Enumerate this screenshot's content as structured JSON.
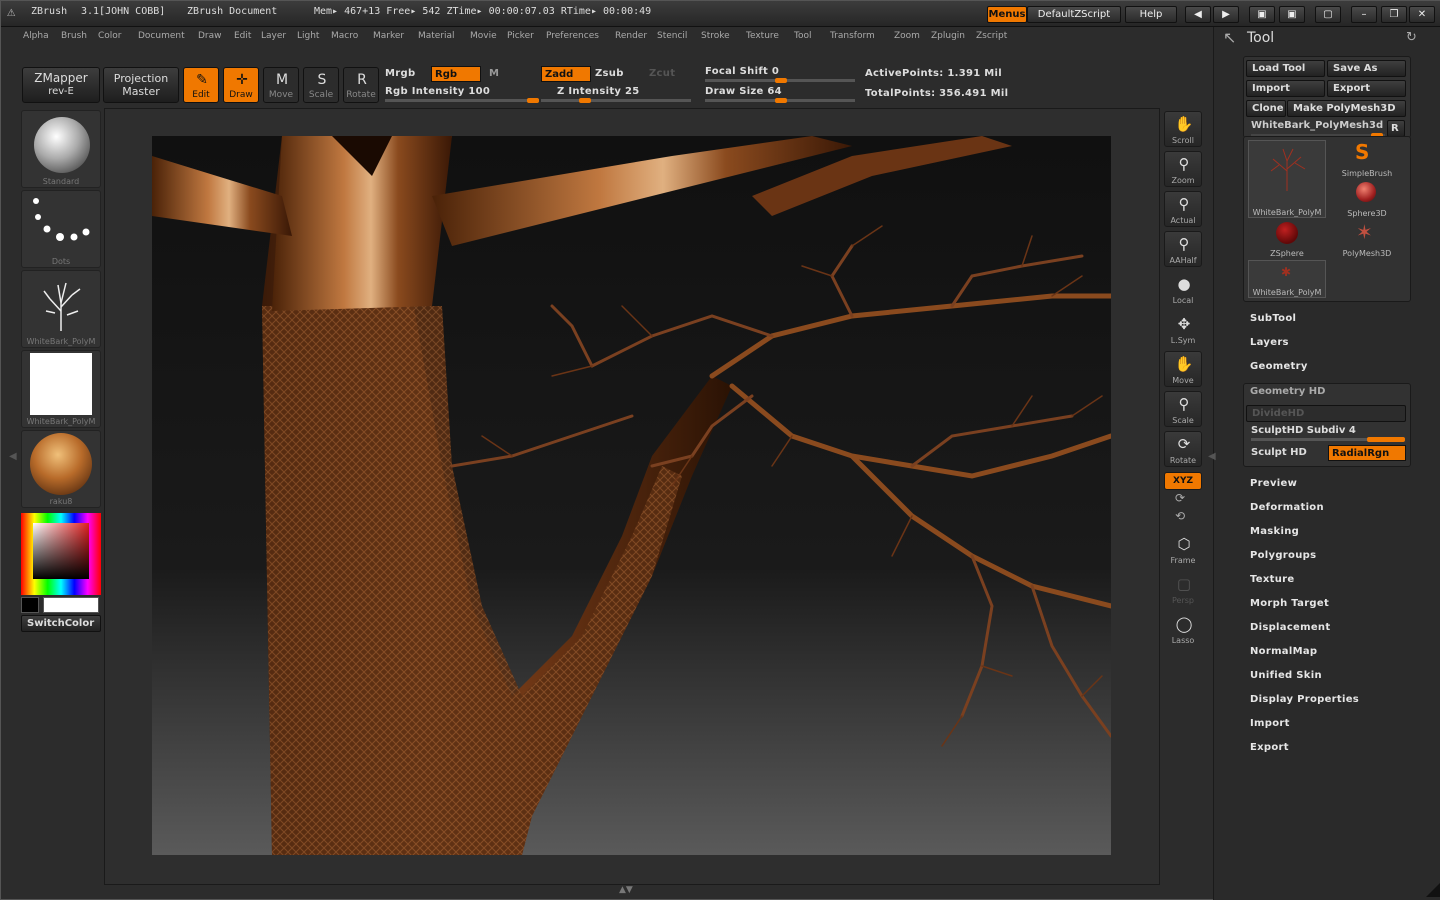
{
  "titlebar": {
    "app": "ZBrush",
    "version": "3.1[JOHN COBB]",
    "document": "ZBrush Document",
    "mem": "Mem▸ 467+13  Free▸ 542  ZTime▸ 00:00:07.03  RTime▸ 00:00:49",
    "menus_label": "Menus",
    "script_label": "DefaultZScript",
    "help_label": "Help"
  },
  "menubar": [
    "Alpha",
    "Brush",
    "Color",
    "Document",
    "Draw",
    "Edit",
    "Layer",
    "Light",
    "Macro",
    "Marker",
    "Material",
    "Movie",
    "Picker",
    "Preferences",
    "Render",
    "Stencil",
    "Stroke",
    "Texture",
    "Tool",
    "Transform",
    "Zoom",
    "Zplugin",
    "Zscript"
  ],
  "toolbar": {
    "zmapper": "ZMapper",
    "zmapper_sub": "rev-E",
    "projection": "Projection",
    "projection_sub": "Master",
    "edit": "Edit",
    "draw": "Draw",
    "move": "Move",
    "scale": "Scale",
    "rotate": "Rotate",
    "mrgb": "Mrgb",
    "rgb": "Rgb",
    "m": "M",
    "rgb_intensity": "Rgb  Intensity 100",
    "zadd": "Zadd",
    "zsub": "Zsub",
    "zcut": "Zcut",
    "z_intensity": "Z  Intensity 25",
    "focal_shift": "Focal  Shift 0",
    "draw_size": "Draw  Size 64",
    "active_points": "ActivePoints: 1.391  Mil",
    "total_points": "TotalPoints: 356.491  Mil"
  },
  "left_shelf": {
    "items": [
      "Standard",
      "Dots",
      "WhiteBark_PolyM",
      "WhiteBark_PolyM",
      "raku8"
    ],
    "switch_color": "SwitchColor"
  },
  "right_tools": [
    "Scroll",
    "Zoom",
    "Actual",
    "AAHalf",
    "Local",
    "L.Sym",
    "Move",
    "Scale",
    "Rotate",
    "Frame",
    "Persp",
    "Lasso"
  ],
  "right_tools_xyz": "XYZ",
  "tool_panel": {
    "title": "Tool",
    "load_tool": "Load  Tool",
    "save_as": "Save  As",
    "import": "Import",
    "export": "Export",
    "clone": "Clone",
    "make_polymesh": "Make  PolyMesh3D",
    "current_tool": "WhiteBark_PolyMesh3d",
    "r_label": "R",
    "grid": [
      {
        "name": "WhiteBark_PolyM"
      },
      {
        "name": "SimpleBrush"
      },
      {
        "name": "Sphere3D"
      },
      {
        "name": "ZSphere"
      },
      {
        "name": "PolyMesh3D"
      },
      {
        "name": "WhiteBark_PolyM"
      }
    ],
    "sections_a": [
      "SubTool",
      "Layers",
      "Geometry"
    ],
    "geometry_hd": "Geometry  HD",
    "divide_hd": "DivideHD",
    "sculpthd_subdiv": "SculptHD  Subdiv 4",
    "sculpt_hd": "Sculpt  HD",
    "radial_rgn": "RadialRgn",
    "sections_b": [
      "Preview",
      "Deformation",
      "Masking",
      "Polygroups",
      "Texture",
      "Morph Target",
      "Displacement",
      "NormalMap",
      "Unified Skin",
      "Display Properties",
      "Import",
      "Export"
    ]
  },
  "colors": {
    "accent": "#f07800",
    "panel": "#2a2a2a",
    "canvas_bg": "#141414",
    "bark": "#7a4722"
  }
}
